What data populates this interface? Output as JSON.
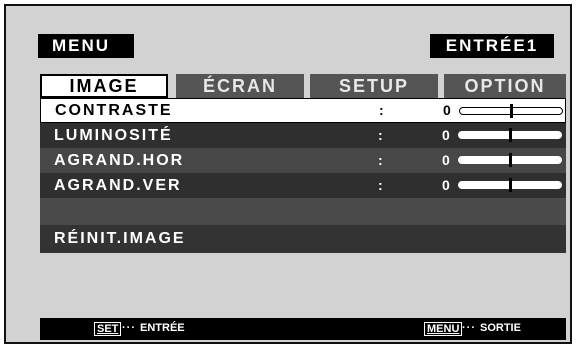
{
  "header": {
    "menu_label": "MENU",
    "input_label": "ENTRÉE1"
  },
  "tabs": [
    {
      "label": "IMAGE",
      "active": true
    },
    {
      "label": "ÉCRAN",
      "active": false
    },
    {
      "label": "SETUP",
      "active": false
    },
    {
      "label": "OPTION",
      "active": false
    }
  ],
  "rows": [
    {
      "label": "CONTRASTE",
      "colon": ":",
      "value": "0",
      "level": 0.5
    },
    {
      "label": "LUMINOSITÉ",
      "colon": ":",
      "value": "0",
      "level": 0.5
    },
    {
      "label": "AGRAND.HOR",
      "colon": ":",
      "value": "0",
      "level": 0.5
    },
    {
      "label": "AGRAND.VER",
      "colon": ":",
      "value": "0",
      "level": 0.5
    }
  ],
  "reset_label": "RÉINIT.IMAGE",
  "footer": {
    "set_key": "SET",
    "set_dots": "···",
    "set_text": "ENTRÉE",
    "menu_key": "MENU",
    "menu_dots": "···",
    "menu_text": "SORTIE"
  }
}
